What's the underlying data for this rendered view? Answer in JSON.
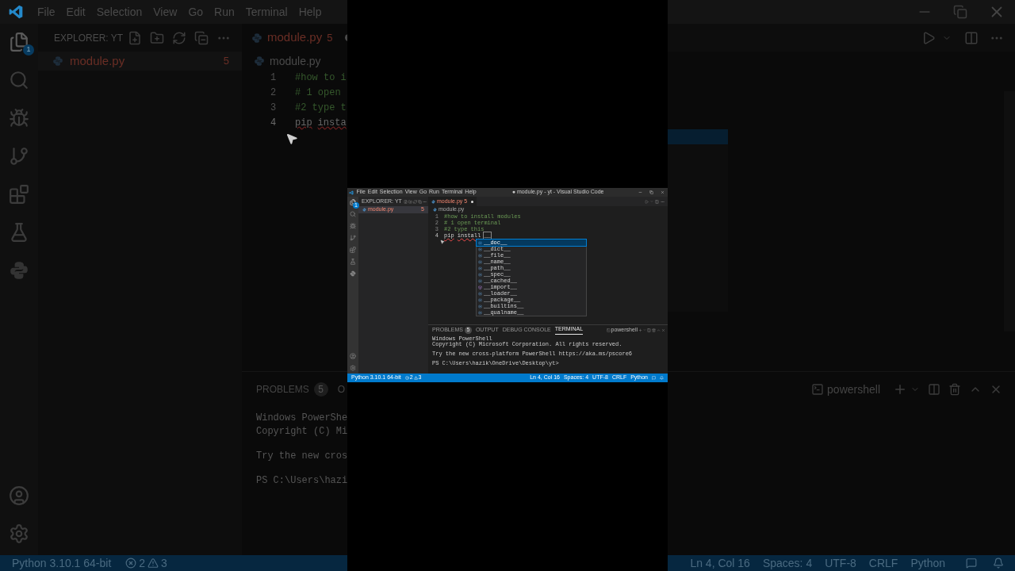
{
  "background_left": {
    "menu": [
      "File",
      "Edit",
      "Selection",
      "View",
      "Go",
      "Run",
      "Terminal",
      "Help"
    ],
    "explorer_title": "EXPLORER: YT",
    "explorer_badge": "1",
    "file": {
      "name": "module.py",
      "badge": "5"
    },
    "tab": {
      "name": "module.py",
      "badge": "5",
      "modified": true
    },
    "breadcrumb": "module.py",
    "lines": [
      {
        "number": "1",
        "tokens": [
          {
            "text": "#how to i",
            "kind": "comment"
          }
        ]
      },
      {
        "number": "2",
        "tokens": [
          {
            "text": "# 1 open",
            "kind": "comment"
          }
        ]
      },
      {
        "number": "3",
        "tokens": [
          {
            "text": "#2 type t",
            "kind": "comment"
          }
        ]
      },
      {
        "number": "4",
        "tokens": [
          {
            "text": "pip",
            "kind": "error"
          },
          {
            "text": "insta",
            "kind": "error"
          }
        ]
      }
    ],
    "panel_tabs": [
      {
        "label": "PROBLEMS",
        "count": "5",
        "selected": false
      },
      {
        "label": "O",
        "selected": false
      }
    ],
    "terminal_blocks": [
      [
        "Windows PowerShe",
        "Copyright (C) Mi"
      ],
      [
        "Try the new cros"
      ],
      [
        "PS C:\\Users\\hazi"
      ]
    ],
    "status": {
      "interpreter": "Python 3.10.1 64-bit",
      "errors": "2",
      "warnings": "3"
    }
  },
  "window": {
    "menu": [
      "File",
      "Edit",
      "Selection",
      "View",
      "Go",
      "Run",
      "Terminal",
      "Help"
    ],
    "title": "● module.py - yt - Visual Studio Code",
    "explorer_title": "EXPLORER: YT",
    "explorer_badge": "1",
    "file": {
      "name": "module.py",
      "badge": "5"
    },
    "tab": {
      "name": "module.py",
      "badge": "5",
      "modified": true
    },
    "breadcrumb": "module.py",
    "lines": [
      {
        "number": "1",
        "tokens": [
          {
            "text": "#how to install modules",
            "kind": "comment"
          }
        ]
      },
      {
        "number": "2",
        "tokens": [
          {
            "text": "# 1 open terminal",
            "kind": "comment"
          }
        ]
      },
      {
        "number": "3",
        "tokens": [
          {
            "text": "#2 type this",
            "kind": "comment"
          }
        ]
      },
      {
        "number": "4",
        "tokens": [
          {
            "text": "pip",
            "kind": "error"
          },
          {
            "text": "install",
            "kind": "error"
          },
          {
            "text": "__",
            "kind": "plain"
          }
        ]
      }
    ],
    "suggestions": [
      {
        "label": "__doc__",
        "kind": "variable",
        "selected": true
      },
      {
        "label": "__dict__",
        "kind": "variable",
        "selected": false
      },
      {
        "label": "__file__",
        "kind": "variable",
        "selected": false
      },
      {
        "label": "__name__",
        "kind": "variable",
        "selected": false
      },
      {
        "label": "__path__",
        "kind": "variable",
        "selected": false
      },
      {
        "label": "__spec__",
        "kind": "variable",
        "selected": false
      },
      {
        "label": "__cached__",
        "kind": "variable",
        "selected": false
      },
      {
        "label": "__import__",
        "kind": "function",
        "selected": false
      },
      {
        "label": "__loader__",
        "kind": "variable",
        "selected": false
      },
      {
        "label": "__package__",
        "kind": "variable",
        "selected": false
      },
      {
        "label": "__builtins__",
        "kind": "variable",
        "selected": false
      },
      {
        "label": "__qualname__",
        "kind": "variable",
        "selected": false
      }
    ],
    "panel_tabs": [
      {
        "label": "PROBLEMS",
        "count": "5",
        "selected": false
      },
      {
        "label": "OUTPUT",
        "selected": false
      },
      {
        "label": "DEBUG CONSOLE",
        "selected": false
      },
      {
        "label": "TERMINAL",
        "selected": true
      }
    ],
    "terminal_profile": "powershell",
    "terminal_blocks": [
      [
        "Windows PowerShell",
        "Copyright (C) Microsoft Corporation. All rights reserved."
      ],
      [
        "Try the new cross-platform PowerShell https://aka.ms/pscore6"
      ],
      [
        "PS C:\\Users\\hazik\\OneDrive\\Desktop\\yt> "
      ]
    ],
    "status": {
      "interpreter": "Python 3.10.1 64-bit",
      "errors": "2",
      "warnings": "3"
    },
    "status_right": [
      "Ln 4, Col 16",
      "Spaces: 4",
      "UTF-8",
      "CRLF",
      "Python"
    ]
  },
  "background_right": {
    "terminal_profile": "powershell",
    "status_right": [
      "Ln 4, Col 16",
      "Spaces: 4",
      "UTF-8",
      "CRLF",
      "Python"
    ]
  }
}
